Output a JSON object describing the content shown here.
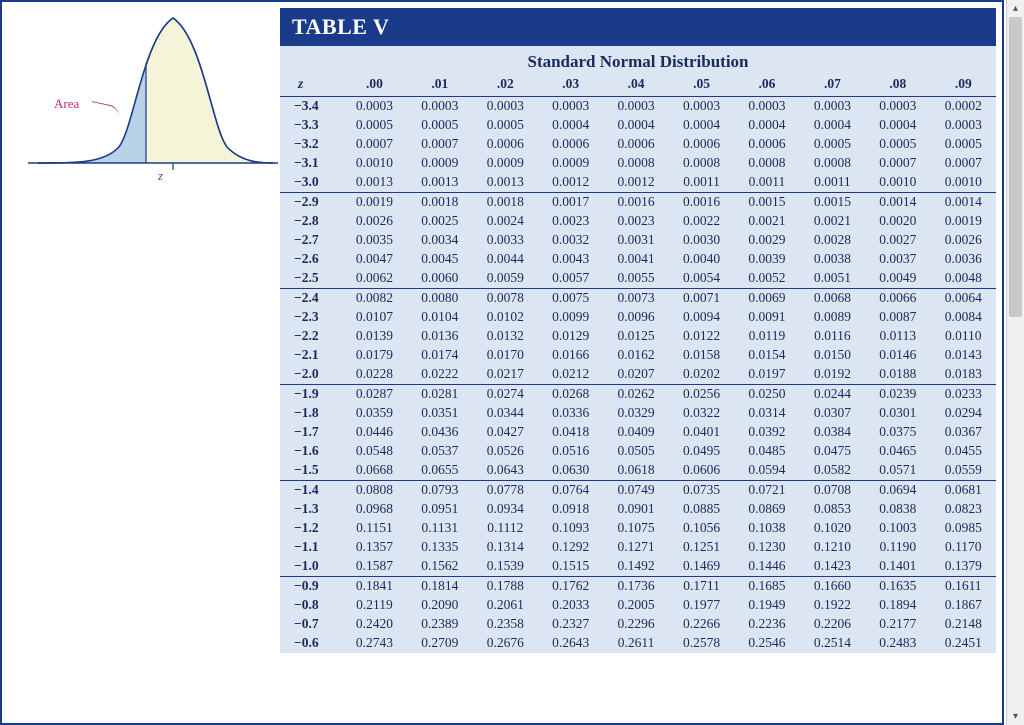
{
  "table_header": "TABLE V",
  "table_title": "Standard Normal Distribution",
  "figure": {
    "area_label": "Area",
    "z_label": "z"
  },
  "columns": [
    "z",
    ".00",
    ".01",
    ".02",
    ".03",
    ".04",
    ".05",
    ".06",
    ".07",
    ".08",
    ".09"
  ],
  "groups": [
    {
      "rows": [
        {
          "z": "−3.4",
          "v": [
            "0.0003",
            "0.0003",
            "0.0003",
            "0.0003",
            "0.0003",
            "0.0003",
            "0.0003",
            "0.0003",
            "0.0003",
            "0.0002"
          ]
        },
        {
          "z": "−3.3",
          "v": [
            "0.0005",
            "0.0005",
            "0.0005",
            "0.0004",
            "0.0004",
            "0.0004",
            "0.0004",
            "0.0004",
            "0.0004",
            "0.0003"
          ]
        },
        {
          "z": "−3.2",
          "v": [
            "0.0007",
            "0.0007",
            "0.0006",
            "0.0006",
            "0.0006",
            "0.0006",
            "0.0006",
            "0.0005",
            "0.0005",
            "0.0005"
          ]
        },
        {
          "z": "−3.1",
          "v": [
            "0.0010",
            "0.0009",
            "0.0009",
            "0.0009",
            "0.0008",
            "0.0008",
            "0.0008",
            "0.0008",
            "0.0007",
            "0.0007"
          ]
        },
        {
          "z": "−3.0",
          "v": [
            "0.0013",
            "0.0013",
            "0.0013",
            "0.0012",
            "0.0012",
            "0.0011",
            "0.0011",
            "0.0011",
            "0.0010",
            "0.0010"
          ]
        }
      ]
    },
    {
      "rows": [
        {
          "z": "−2.9",
          "v": [
            "0.0019",
            "0.0018",
            "0.0018",
            "0.0017",
            "0.0016",
            "0.0016",
            "0.0015",
            "0.0015",
            "0.0014",
            "0.0014"
          ]
        },
        {
          "z": "−2.8",
          "v": [
            "0.0026",
            "0.0025",
            "0.0024",
            "0.0023",
            "0.0023",
            "0.0022",
            "0.0021",
            "0.0021",
            "0.0020",
            "0.0019"
          ]
        },
        {
          "z": "−2.7",
          "v": [
            "0.0035",
            "0.0034",
            "0.0033",
            "0.0032",
            "0.0031",
            "0.0030",
            "0.0029",
            "0.0028",
            "0.0027",
            "0.0026"
          ]
        },
        {
          "z": "−2.6",
          "v": [
            "0.0047",
            "0.0045",
            "0.0044",
            "0.0043",
            "0.0041",
            "0.0040",
            "0.0039",
            "0.0038",
            "0.0037",
            "0.0036"
          ]
        },
        {
          "z": "−2.5",
          "v": [
            "0.0062",
            "0.0060",
            "0.0059",
            "0.0057",
            "0.0055",
            "0.0054",
            "0.0052",
            "0.0051",
            "0.0049",
            "0.0048"
          ]
        }
      ]
    },
    {
      "rows": [
        {
          "z": "−2.4",
          "v": [
            "0.0082",
            "0.0080",
            "0.0078",
            "0.0075",
            "0.0073",
            "0.0071",
            "0.0069",
            "0.0068",
            "0.0066",
            "0.0064"
          ]
        },
        {
          "z": "−2.3",
          "v": [
            "0.0107",
            "0.0104",
            "0.0102",
            "0.0099",
            "0.0096",
            "0.0094",
            "0.0091",
            "0.0089",
            "0.0087",
            "0.0084"
          ]
        },
        {
          "z": "−2.2",
          "v": [
            "0.0139",
            "0.0136",
            "0.0132",
            "0.0129",
            "0.0125",
            "0.0122",
            "0.0119",
            "0.0116",
            "0.0113",
            "0.0110"
          ]
        },
        {
          "z": "−2.1",
          "v": [
            "0.0179",
            "0.0174",
            "0.0170",
            "0.0166",
            "0.0162",
            "0.0158",
            "0.0154",
            "0.0150",
            "0.0146",
            "0.0143"
          ]
        },
        {
          "z": "−2.0",
          "v": [
            "0.0228",
            "0.0222",
            "0.0217",
            "0.0212",
            "0.0207",
            "0.0202",
            "0.0197",
            "0.0192",
            "0.0188",
            "0.0183"
          ]
        }
      ]
    },
    {
      "rows": [
        {
          "z": "−1.9",
          "v": [
            "0.0287",
            "0.0281",
            "0.0274",
            "0.0268",
            "0.0262",
            "0.0256",
            "0.0250",
            "0.0244",
            "0.0239",
            "0.0233"
          ]
        },
        {
          "z": "−1.8",
          "v": [
            "0.0359",
            "0.0351",
            "0.0344",
            "0.0336",
            "0.0329",
            "0.0322",
            "0.0314",
            "0.0307",
            "0.0301",
            "0.0294"
          ]
        },
        {
          "z": "−1.7",
          "v": [
            "0.0446",
            "0.0436",
            "0.0427",
            "0.0418",
            "0.0409",
            "0.0401",
            "0.0392",
            "0.0384",
            "0.0375",
            "0.0367"
          ]
        },
        {
          "z": "−1.6",
          "v": [
            "0.0548",
            "0.0537",
            "0.0526",
            "0.0516",
            "0.0505",
            "0.0495",
            "0.0485",
            "0.0475",
            "0.0465",
            "0.0455"
          ]
        },
        {
          "z": "−1.5",
          "v": [
            "0.0668",
            "0.0655",
            "0.0643",
            "0.0630",
            "0.0618",
            "0.0606",
            "0.0594",
            "0.0582",
            "0.0571",
            "0.0559"
          ]
        }
      ]
    },
    {
      "rows": [
        {
          "z": "−1.4",
          "v": [
            "0.0808",
            "0.0793",
            "0.0778",
            "0.0764",
            "0.0749",
            "0.0735",
            "0.0721",
            "0.0708",
            "0.0694",
            "0.0681"
          ]
        },
        {
          "z": "−1.3",
          "v": [
            "0.0968",
            "0.0951",
            "0.0934",
            "0.0918",
            "0.0901",
            "0.0885",
            "0.0869",
            "0.0853",
            "0.0838",
            "0.0823"
          ]
        },
        {
          "z": "−1.2",
          "v": [
            "0.1151",
            "0.1131",
            "0.1112",
            "0.1093",
            "0.1075",
            "0.1056",
            "0.1038",
            "0.1020",
            "0.1003",
            "0.0985"
          ]
        },
        {
          "z": "−1.1",
          "v": [
            "0.1357",
            "0.1335",
            "0.1314",
            "0.1292",
            "0.1271",
            "0.1251",
            "0.1230",
            "0.1210",
            "0.1190",
            "0.1170"
          ]
        },
        {
          "z": "−1.0",
          "v": [
            "0.1587",
            "0.1562",
            "0.1539",
            "0.1515",
            "0.1492",
            "0.1469",
            "0.1446",
            "0.1423",
            "0.1401",
            "0.1379"
          ]
        }
      ]
    },
    {
      "rows": [
        {
          "z": "−0.9",
          "v": [
            "0.1841",
            "0.1814",
            "0.1788",
            "0.1762",
            "0.1736",
            "0.1711",
            "0.1685",
            "0.1660",
            "0.1635",
            "0.1611"
          ]
        },
        {
          "z": "−0.8",
          "v": [
            "0.2119",
            "0.2090",
            "0.2061",
            "0.2033",
            "0.2005",
            "0.1977",
            "0.1949",
            "0.1922",
            "0.1894",
            "0.1867"
          ]
        },
        {
          "z": "−0.7",
          "v": [
            "0.2420",
            "0.2389",
            "0.2358",
            "0.2327",
            "0.2296",
            "0.2266",
            "0.2236",
            "0.2206",
            "0.2177",
            "0.2148"
          ]
        },
        {
          "z": "−0.6",
          "v": [
            "0.2743",
            "0.2709",
            "0.2676",
            "0.2643",
            "0.2611",
            "0.2578",
            "0.2546",
            "0.2514",
            "0.2483",
            "0.2451"
          ]
        }
      ]
    }
  ],
  "chart_data": {
    "type": "area",
    "title": "Standard normal density with left-tail area shaded to z",
    "x_range": [
      -3.5,
      3.5
    ],
    "shade_to": -1.0,
    "annotations": [
      "Area",
      "z"
    ]
  }
}
